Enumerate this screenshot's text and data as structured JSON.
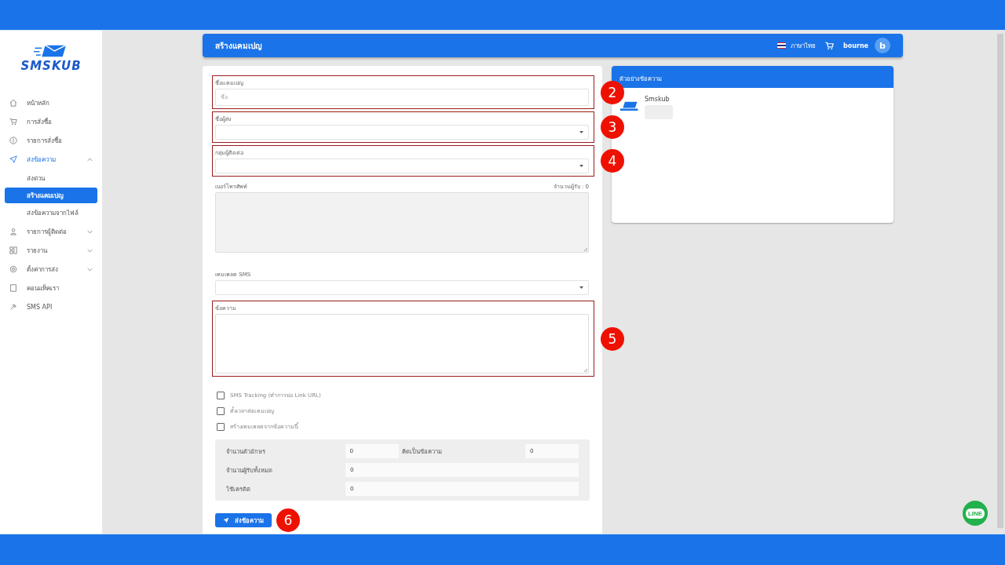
{
  "logo": {
    "text": "SMSKUB"
  },
  "sidebar": {
    "items": [
      {
        "label": "หน้าหลัก",
        "selected": false
      },
      {
        "label": "การสั่งซื้อ",
        "selected": false
      },
      {
        "label": "รายการสั่งซื้อ",
        "selected": false
      },
      {
        "label": "ส่งข้อความ",
        "selected": false,
        "expanded": true,
        "children": [
          {
            "label": "ส่งด่วน",
            "selected": false
          },
          {
            "label": "สร้างแคมเปญ",
            "selected": true
          },
          {
            "label": "ส่งข้อความจากไฟล์",
            "selected": false
          }
        ]
      },
      {
        "label": "รายการผู้ติดต่อ",
        "selected": false,
        "expanded": false
      },
      {
        "label": "รายงาน",
        "selected": false,
        "expanded": false
      },
      {
        "label": "ตั้งค่าการส่ง",
        "selected": false,
        "expanded": false
      },
      {
        "label": "คอนแท็คเรา",
        "selected": false
      },
      {
        "label": "SMS API",
        "selected": false
      }
    ]
  },
  "header": {
    "title": "สร้างแคมเปญ",
    "language": "ภาษาไทย",
    "username": "bourne",
    "avatar": "b"
  },
  "form": {
    "fields": [
      {
        "kind": "text",
        "label": "ชื่อแคมเปญ",
        "placeholder": "ชื่อ",
        "marker": "2"
      },
      {
        "kind": "select",
        "label": "ชื่อผู้ส่ง",
        "marker": "3"
      },
      {
        "kind": "select",
        "label": "กลุ่มผู้ติดต่อ",
        "marker": "4"
      },
      {
        "kind": "textarea",
        "label": "เบอร์โทรศัพท์",
        "counter": "จำนวนผู้รับ : 0",
        "disabled": true
      },
      {
        "kind": "select",
        "label": "เทมเพลต SMS"
      },
      {
        "kind": "textarea",
        "label": "ข้อความ",
        "marker": "5",
        "disabled": false
      }
    ],
    "checkboxes": [
      {
        "label": "SMS Tracking (ทำการย่อ Link URL)",
        "checked": false
      },
      {
        "label": "ตั้งเวลาส่งแคมเปญ",
        "checked": false
      },
      {
        "label": "สร้างเทมเพลตจากข้อความนี้",
        "checked": false
      }
    ],
    "stats": [
      {
        "label": "จำนวนตัวอักษร",
        "value": "0",
        "label_2": "คิดเป็นข้อความ",
        "value_2": "0"
      },
      {
        "label": "จำนวนผู้รับทั้งหมด",
        "value": "0"
      },
      {
        "label": "ใช้เครดิต",
        "value": "0"
      }
    ],
    "submit": {
      "label": "ส่งข้อความ",
      "marker": "6"
    }
  },
  "preview": {
    "title": "ตัวอย่างข้อความ",
    "sender": "Smskub"
  },
  "chat_button": {
    "label": "LINE"
  }
}
